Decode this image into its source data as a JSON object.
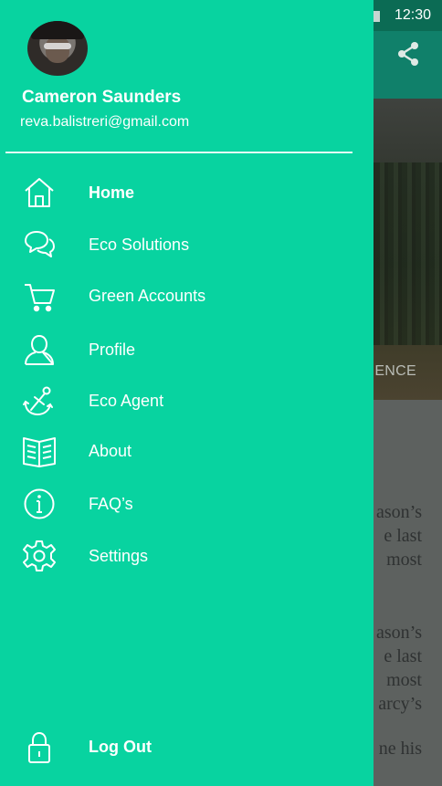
{
  "status_bar": {
    "time": "12:30"
  },
  "background": {
    "hero_caption": "IENCE",
    "paragraph1": [
      "ason’s",
      "e last",
      "most"
    ],
    "paragraph2": [
      "ason’s",
      "e last",
      "most",
      "arcy’s"
    ],
    "paragraph3": [
      "ne his"
    ]
  },
  "drawer": {
    "user": {
      "name": "Cameron Saunders",
      "email": "reva.balistreri@gmail.com"
    },
    "menu": [
      {
        "label": "Home",
        "icon": "home-icon",
        "active": true
      },
      {
        "label": "Eco Solutions",
        "icon": "chat-bubbles-icon"
      },
      {
        "label": "Green Accounts",
        "icon": "shopping-cart-icon"
      },
      {
        "label": "Profile",
        "icon": "user-icon"
      },
      {
        "label": "Eco Agent",
        "icon": "anchor-icon"
      },
      {
        "label": "About",
        "icon": "book-icon"
      },
      {
        "label": "FAQ’s",
        "icon": "info-icon"
      },
      {
        "label": "Settings",
        "icon": "gear-icon"
      }
    ],
    "logout": {
      "label": "Log Out",
      "icon": "lock-icon"
    }
  },
  "colors": {
    "drawer": "#08d3a0",
    "toolbar": "#10806a",
    "status_bar": "#0b6b54"
  }
}
